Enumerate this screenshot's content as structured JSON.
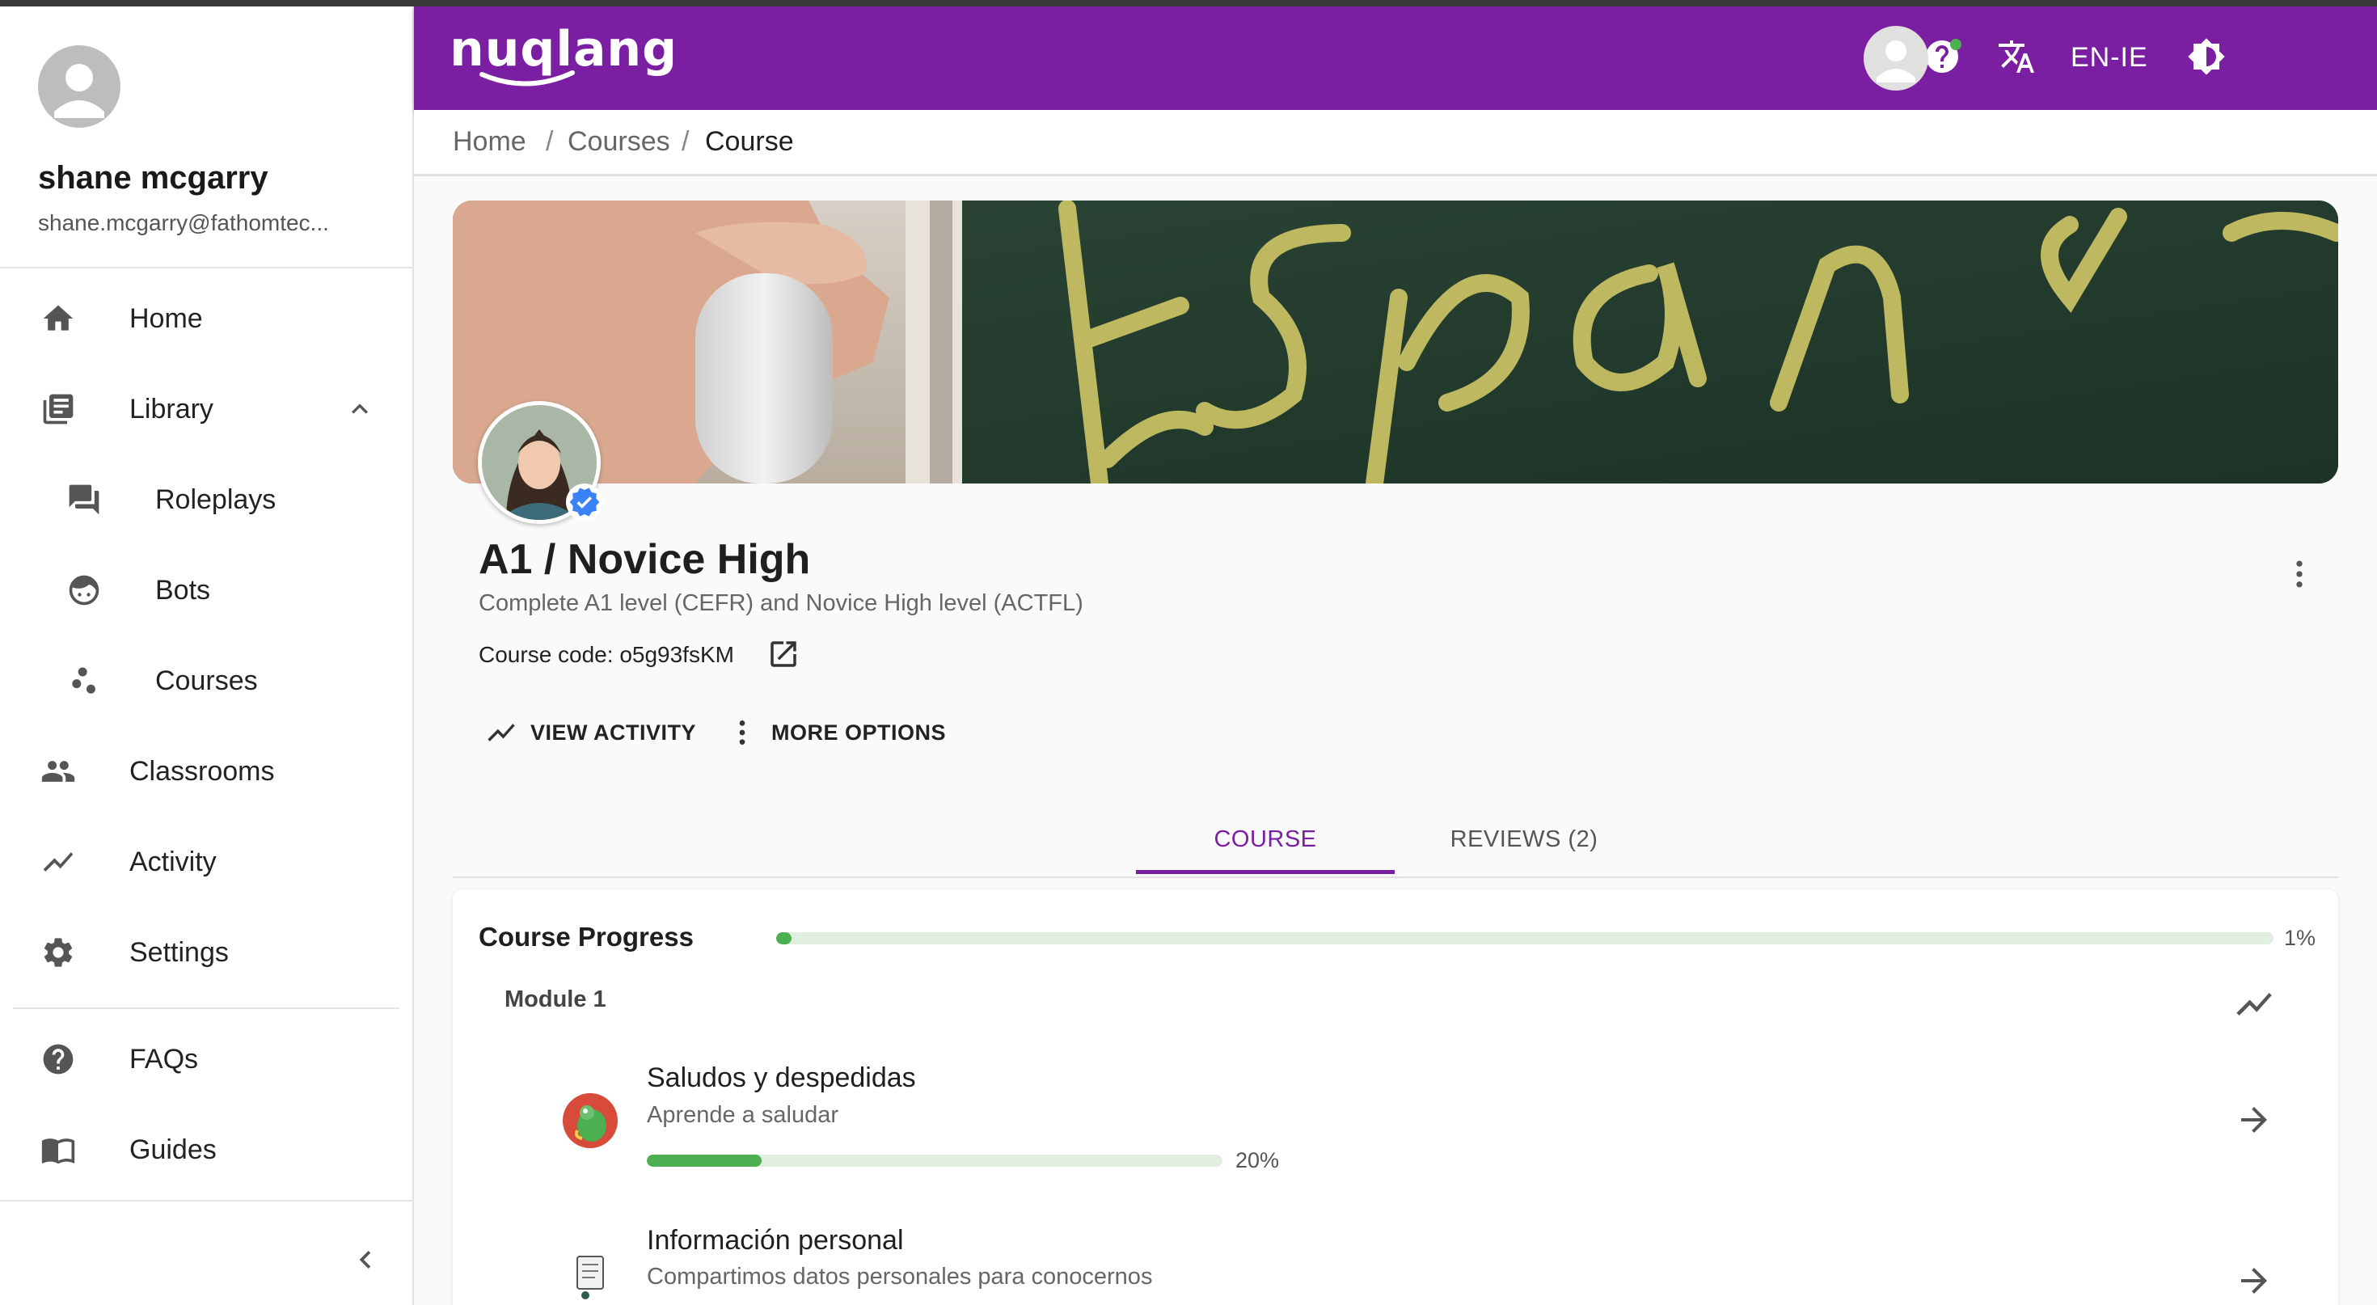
{
  "user": {
    "name": "shane mcgarry",
    "email": "shane.mcgarry@fathomtec..."
  },
  "sidebar": {
    "items": [
      {
        "label": "Home",
        "icon": "home-icon"
      },
      {
        "label": "Library",
        "icon": "library-icon"
      },
      {
        "label": "Roleplays",
        "icon": "chat-icon"
      },
      {
        "label": "Bots",
        "icon": "bot-face-icon"
      },
      {
        "label": "Courses",
        "icon": "courses-dots-icon"
      },
      {
        "label": "Classrooms",
        "icon": "people-icon"
      },
      {
        "label": "Activity",
        "icon": "activity-icon"
      },
      {
        "label": "Settings",
        "icon": "gear-icon"
      },
      {
        "label": "FAQs",
        "icon": "help-circle-icon"
      },
      {
        "label": "Guides",
        "icon": "book-open-icon"
      }
    ]
  },
  "appbar": {
    "logo": "nuqlang",
    "language": "EN-IE"
  },
  "breadcrumb": {
    "home": "Home",
    "courses": "Courses",
    "current": "Course",
    "separator": "/"
  },
  "course": {
    "title": "A1 / Novice High",
    "subtitle": "Complete A1 level (CEFR) and Novice High level (ACTFL)",
    "code_label": "Course code: o5g93fsKM"
  },
  "actions": {
    "view_activity": "VIEW ACTIVITY",
    "more_options": "MORE OPTIONS"
  },
  "tabs": [
    {
      "label": "COURSE",
      "active": true
    },
    {
      "label": "REVIEWS (2)",
      "active": false
    }
  ],
  "progress": {
    "label": "Course Progress",
    "value": 0.01,
    "value_text": "1%",
    "module_label": "Module 1"
  },
  "lessons": [
    {
      "title": "Saludos y despedidas",
      "subtitle": "Aprende a saludar",
      "progress": 0.2,
      "progress_text": "20%"
    },
    {
      "title": "Información personal",
      "subtitle": "Compartimos datos personales para conocernos"
    }
  ],
  "colors": {
    "brand": "#7b1fa2",
    "progress": "#4caf50",
    "progress_track": "#e1efe1"
  }
}
